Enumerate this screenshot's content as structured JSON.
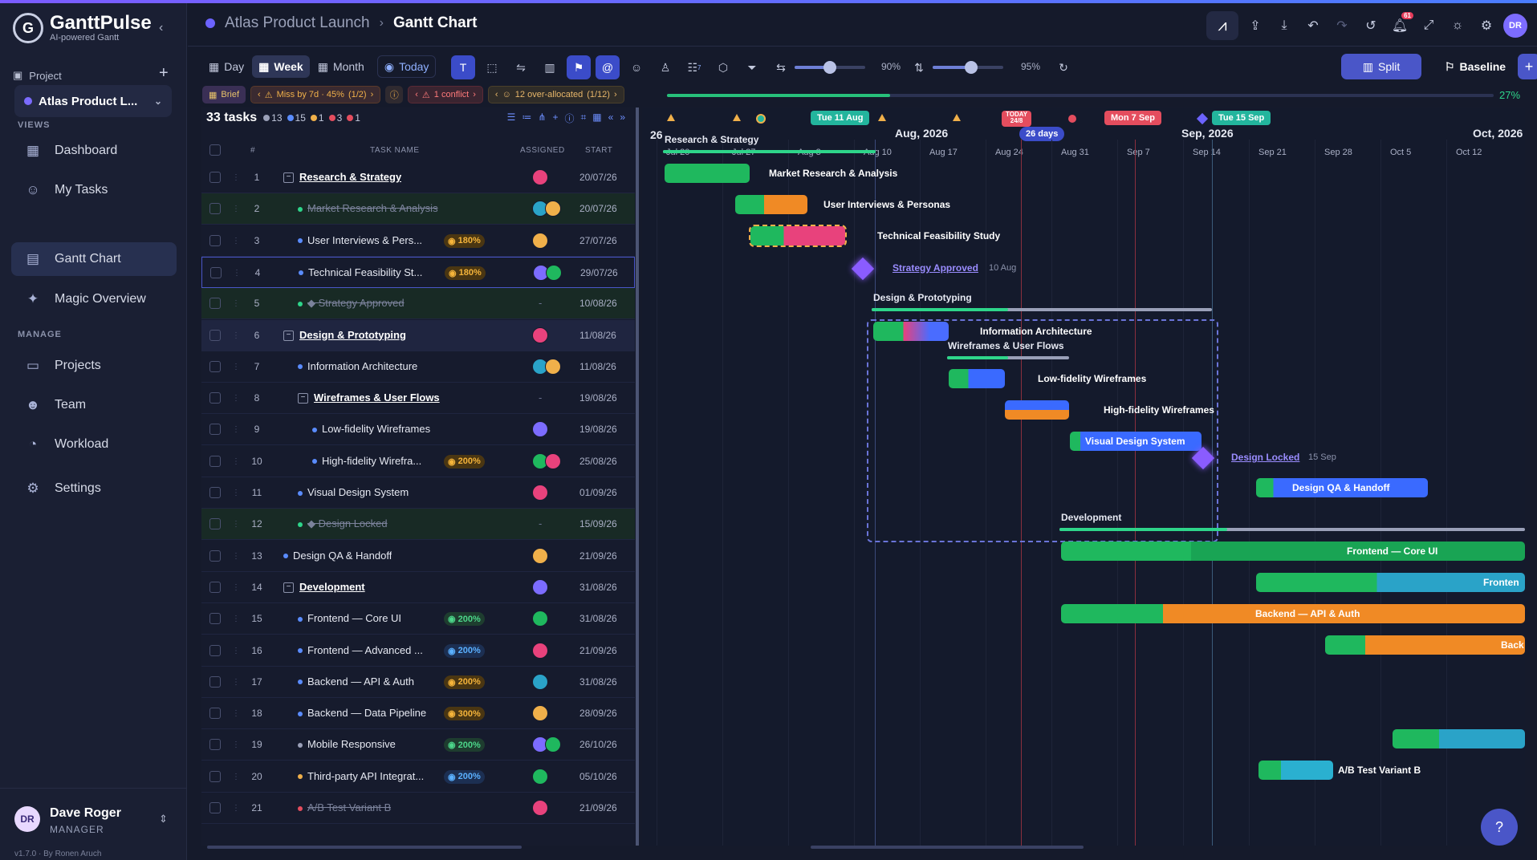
{
  "brand": {
    "name": "GanttPulse",
    "tagline": "AI-powered Gantt",
    "logo": "G"
  },
  "sidebar": {
    "project_label": "Project",
    "project_selected": "Atlas Product L...",
    "views_heading": "VIEWS",
    "views": [
      {
        "label": "Dashboard",
        "icon": "dashboard-icon"
      },
      {
        "label": "My Tasks",
        "icon": "user-icon"
      },
      {
        "label": "Gantt Chart",
        "icon": "gantt-icon",
        "active": true
      },
      {
        "label": "Magic Overview",
        "icon": "sparkle-icon"
      }
    ],
    "manage_heading": "MANAGE",
    "manage": [
      {
        "label": "Projects",
        "icon": "folder-icon"
      },
      {
        "label": "Team",
        "icon": "team-icon"
      },
      {
        "label": "Workload",
        "icon": "gauge-icon"
      },
      {
        "label": "Settings",
        "icon": "gear-icon"
      }
    ],
    "user": {
      "initials": "DR",
      "name": "Dave Roger",
      "role": "MANAGER"
    },
    "version": "v1.7.0 · By Ronen Aruch"
  },
  "header": {
    "project": "Atlas Product Launch",
    "page": "Gantt Chart",
    "notifications": "61",
    "avatar": "DR"
  },
  "toolbar": {
    "views": [
      "Day",
      "Week",
      "Month"
    ],
    "active_view": "Week",
    "today": "Today",
    "zoom_h": "90%",
    "zoom_v": "95%",
    "zoom_h_level": 0.5,
    "zoom_v_level": 0.55,
    "badge_count": "7",
    "split": "Split",
    "baseline": "Baseline"
  },
  "status": {
    "brief": "Brief",
    "miss": "Miss by 7d · 45%",
    "miss_pages": "(1/2)",
    "conflict": "1 conflict",
    "allocated": "12 over-allocated",
    "allocated_pages": "(1/12)",
    "progress": "27%",
    "progress_value": 0.27
  },
  "table": {
    "task_count": "33 tasks",
    "counters": [
      {
        "value": "13",
        "color": "#9aa0b8"
      },
      {
        "value": "15",
        "color": "#5a8cff"
      },
      {
        "value": "1",
        "color": "#f0b04a"
      },
      {
        "value": "3",
        "color": "#e44d5e"
      },
      {
        "value": "1",
        "color": "#e44d5e"
      }
    ],
    "headers": {
      "num": "#",
      "name": "TASK NAME",
      "assigned": "ASSIGNED",
      "start": "START"
    },
    "rows": [
      {
        "n": "1",
        "name": "Research & Strategy",
        "start": "20/07/26",
        "group": true,
        "indent": 0
      },
      {
        "n": "2",
        "name": "Market Research & Analysis",
        "start": "20/07/26",
        "done": true,
        "indent": 1
      },
      {
        "n": "3",
        "name": "User Interviews & Pers...",
        "start": "27/07/26",
        "badge": "180%",
        "badge_color": "amber",
        "indent": 1
      },
      {
        "n": "4",
        "name": "Technical Feasibility St...",
        "start": "29/07/26",
        "badge": "180%",
        "badge_color": "amber",
        "indent": 1
      },
      {
        "n": "5",
        "name": "◆ Strategy Approved",
        "start": "10/08/26",
        "done": true,
        "indent": 1,
        "assigned": "-"
      },
      {
        "n": "6",
        "name": "Design & Prototyping",
        "start": "11/08/26",
        "group": true,
        "indent": 0
      },
      {
        "n": "7",
        "name": "Information Architecture",
        "start": "11/08/26",
        "indent": 1
      },
      {
        "n": "8",
        "name": "Wireframes & User Flows",
        "start": "19/08/26",
        "group": true,
        "indent": 1,
        "assigned": "-"
      },
      {
        "n": "9",
        "name": "Low-fidelity Wireframes",
        "start": "19/08/26",
        "indent": 2
      },
      {
        "n": "10",
        "name": "High-fidelity Wirefra...",
        "start": "25/08/26",
        "badge": "200%",
        "badge_color": "amber",
        "indent": 2
      },
      {
        "n": "11",
        "name": "Visual Design System",
        "start": "01/09/26",
        "indent": 1
      },
      {
        "n": "12",
        "name": "◆ Design Locked",
        "start": "15/09/26",
        "done": true,
        "indent": 1,
        "assigned": "-"
      },
      {
        "n": "13",
        "name": "Design QA & Handoff",
        "start": "21/09/26",
        "indent": 0
      },
      {
        "n": "14",
        "name": "Development",
        "start": "31/08/26",
        "group": true,
        "indent": 0
      },
      {
        "n": "15",
        "name": "Frontend — Core UI",
        "start": "31/08/26",
        "badge": "200%",
        "badge_color": "green",
        "indent": 1
      },
      {
        "n": "16",
        "name": "Frontend — Advanced ...",
        "start": "21/09/26",
        "badge": "200%",
        "badge_color": "blue",
        "indent": 1
      },
      {
        "n": "17",
        "name": "Backend — API & Auth",
        "start": "31/08/26",
        "badge": "200%",
        "badge_color": "amber",
        "indent": 1
      },
      {
        "n": "18",
        "name": "Backend — Data Pipeline",
        "start": "28/09/26",
        "badge": "300%",
        "badge_color": "amber",
        "indent": 1
      },
      {
        "n": "19",
        "name": "Mobile Responsive",
        "start": "26/10/26",
        "badge": "200%",
        "badge_color": "green",
        "indent": 1
      },
      {
        "n": "20",
        "name": "Third-party API Integrat...",
        "start": "05/10/26",
        "badge": "200%",
        "badge_color": "blue",
        "indent": 1
      },
      {
        "n": "21",
        "name": "A/B Test Variant B",
        "start": "21/09/26",
        "done": true,
        "indent": 1
      }
    ]
  },
  "gantt": {
    "edge_label": "26",
    "months": [
      "Aug, 2026",
      "Sep, 2026",
      "Oct, 2026"
    ],
    "weeks": [
      "Jul 20",
      "Jul 27",
      "Aug 3",
      "Aug 10",
      "Aug 17",
      "Aug 24",
      "Aug 31",
      "Sep 7",
      "Sep 14",
      "Sep 21",
      "Sep 28",
      "Oct 5",
      "Oct 12"
    ],
    "flags": {
      "tue11": "Tue 11 Aug",
      "today": "TODAY",
      "today_date": "24/8",
      "mon7": "Mon 7 Sep",
      "tue15": "Tue 15 Sep",
      "days": "26 days"
    },
    "tasks": {
      "research": "Research & Strategy",
      "market": "Market Research & Analysis",
      "interviews": "User Interviews & Personas",
      "feasibility": "Technical Feasibility Study",
      "strategy": "Strategy Approved",
      "strategy_date": "10 Aug",
      "design": "Design & Prototyping",
      "ia": "Information Architecture",
      "wireframes": "Wireframes & User Flows",
      "lowfi": "Low-fidelity Wireframes",
      "hifi": "High-fidelity Wireframes",
      "vds": "Visual Design System",
      "locked": "Design Locked",
      "locked_date": "15 Sep",
      "qa": "Design QA & Handoff",
      "dev": "Development",
      "fe_core": "Frontend — Core UI",
      "fe_adv": "Fronten",
      "be_api": "Backend — API & Auth",
      "be_data": "Back",
      "ab": "A/B Test Variant B"
    }
  }
}
